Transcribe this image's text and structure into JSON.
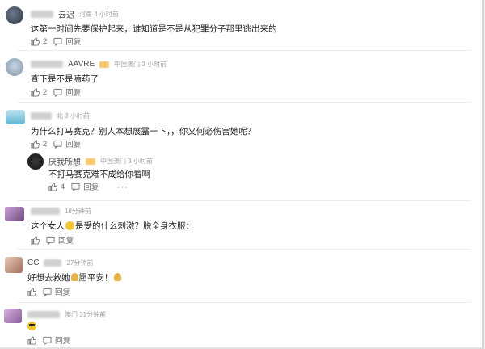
{
  "comments": [
    {
      "name": "云迟",
      "meta": "河南 4 小时前",
      "text": "这第一时间先要保护起来，谁知道是不是从犯罪分子那里逃出来的",
      "like_count": "2",
      "reply_label": "回复"
    },
    {
      "name": "AAVRE",
      "meta": "中国澳门 3 小时前",
      "text": "查下是不是嗑药了",
      "like_count": "2",
      "reply_label": "回复"
    },
    {
      "name": "",
      "meta": "北 3 小时前",
      "text": "为什么打马赛克？别人本想展露一下，，你又何必伤害她呢？",
      "like_count": "2",
      "reply_label": "回复",
      "reply": {
        "name": "厌我所想",
        "meta": "中国澳门 3 小时前",
        "text": "不打马赛克难不成给你看啊",
        "like_count": "4",
        "reply_label": "回复",
        "more": "···"
      }
    },
    {
      "name": "",
      "meta": "18分钟前",
      "text_before": "这个女人",
      "text_after": "是受的什么刺激？脱全身衣服：",
      "reply_label": "回复"
    },
    {
      "name": "CC",
      "meta": "27分钟前",
      "text_before": "好想去救她",
      "text_middle": "愿平安！",
      "reply_label": "回复"
    },
    {
      "name": "",
      "meta": "澳门 31分钟前",
      "reply_label": "回复"
    }
  ],
  "colors": {
    "accent_badge": "#f7c76b",
    "meta_text": "#a0a0a0",
    "action_text": "#6f6f6f"
  }
}
